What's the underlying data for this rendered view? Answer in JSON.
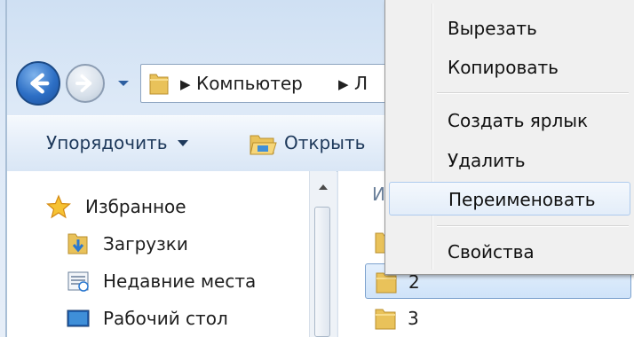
{
  "window": {
    "address": {
      "crumbs": [
        "Компьютер",
        "Л"
      ]
    },
    "toolbar": {
      "organize_label": "Упорядочить",
      "open_label": "Открыть"
    },
    "nav_pane": {
      "items": [
        {
          "label": "Избранное",
          "icon": "star-icon"
        },
        {
          "label": "Загрузки",
          "icon": "downloads-folder-icon"
        },
        {
          "label": "Недавние места",
          "icon": "recent-places-icon"
        },
        {
          "label": "Рабочий стол",
          "icon": "desktop-icon"
        }
      ]
    },
    "file_pane": {
      "column_header": "И",
      "items": [
        {
          "label": "",
          "icon": "folder-icon",
          "selected": false
        },
        {
          "label": "2",
          "icon": "folder-icon",
          "selected": true
        },
        {
          "label": "3",
          "icon": "folder-icon",
          "selected": false
        }
      ]
    }
  },
  "context_menu": {
    "items": [
      {
        "label": "Вырезать",
        "hover": false
      },
      {
        "label": "Копировать",
        "hover": false
      },
      {
        "label": "Создать ярлык",
        "hover": false
      },
      {
        "label": "Удалить",
        "hover": false
      },
      {
        "label": "Переименовать",
        "hover": true
      },
      {
        "label": "Свойства",
        "hover": false
      }
    ]
  },
  "colors": {
    "accent_blue": "#2d6fc5",
    "folder_yellow": "#e9c25a",
    "selection_border": "#7da2ce",
    "menu_background": "#f0f0f0"
  }
}
